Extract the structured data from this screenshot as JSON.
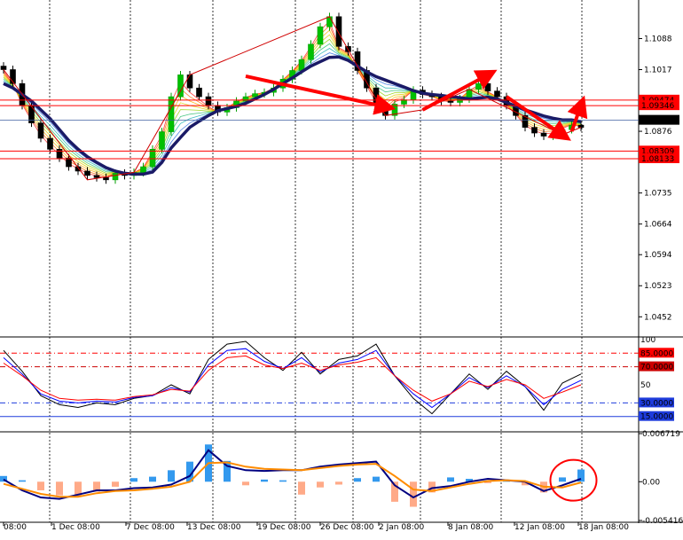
{
  "chart_data": [
    {
      "type": "candlestick",
      "title": "",
      "price_axis_ticks": [
        1.1088,
        1.1017,
        1.0876,
        1.0735,
        1.0664,
        1.0594,
        1.0523,
        1.0452
      ],
      "ylim": [
        1.041,
        1.117
      ],
      "horizontal_levels": [
        {
          "label": "1.09474",
          "value": 1.09474,
          "color": "#ff0000"
        },
        {
          "label": "1.09346",
          "value": 1.09346,
          "color": "#ff0000"
        },
        {
          "label": "1.08309",
          "value": 1.08309,
          "color": "#ff0000"
        },
        {
          "label": "1.08133",
          "value": 1.08133,
          "color": "#ff0000"
        }
      ],
      "current_price": {
        "label": "1.09012",
        "value": 1.09012
      },
      "series": [
        {
          "name": "",
          "role": "close",
          "values": [
            1.1017,
            1.0985,
            1.0935,
            1.0895,
            1.086,
            1.0835,
            1.0815,
            1.0795,
            1.0785,
            1.0775,
            1.077,
            1.0765,
            1.078,
            1.0775,
            1.0782,
            1.0795,
            1.0835,
            1.0875,
            1.0955,
            1.1005,
            1.0975,
            1.0955,
            1.0935,
            1.092,
            1.093,
            1.0945,
            1.0955,
            1.0962,
            1.0965,
            1.0975,
            1.0995,
            1.1015,
            1.104,
            1.1075,
            1.1115,
            1.1138,
            1.107,
            1.1058,
            1.1015,
            1.0975,
            1.0935,
            1.0912,
            1.0938,
            1.0948,
            1.097,
            1.096,
            1.0955,
            1.0945,
            1.0942,
            1.095,
            1.0972,
            1.0985,
            1.0968,
            1.0955,
            1.0935,
            1.0912,
            1.0885,
            1.0872,
            1.0865,
            1.0868,
            1.088,
            1.089,
            1.0885
          ]
        },
        {
          "name": "",
          "role": "moving-average",
          "values": [
            1.0985,
            1.0975,
            1.096,
            1.0945,
            1.0925,
            1.0905,
            1.088,
            1.0855,
            1.0835,
            1.0818,
            1.0805,
            1.0793,
            1.0785,
            1.078,
            1.0778,
            1.0778,
            1.0783,
            1.0805,
            1.0838,
            1.0862,
            1.0885,
            1.0899,
            1.0912,
            1.0923,
            1.0928,
            1.0933,
            1.094,
            1.095,
            1.096,
            1.0972,
            1.0985,
            1.0998,
            1.1012,
            1.1025,
            1.1035,
            1.1045,
            1.1046,
            1.1038,
            1.1025,
            1.1012,
            1.1001,
            1.0993,
            1.0985,
            1.0977,
            1.0969,
            1.0963,
            1.096,
            1.0958,
            1.0955,
            1.0953,
            1.095,
            1.0952,
            1.0954,
            1.095,
            1.0942,
            1.0933,
            1.0925,
            1.0918,
            1.0911,
            1.0906,
            1.0902,
            1.0902,
            1.0898
          ]
        }
      ],
      "trend_arrows": [
        {
          "from": [
            26,
            1.1002
          ],
          "to": [
            41,
            1.0932
          ],
          "color": "#ff0000"
        },
        {
          "from": [
            45,
            1.0925
          ],
          "to": [
            52,
            1.1005
          ],
          "color": "#ff0000"
        },
        {
          "from": [
            54,
            1.0955
          ],
          "to": [
            60,
            1.0868
          ],
          "color": "#ff0000"
        },
        {
          "from": [
            61,
            1.0876
          ],
          "to": [
            62,
            1.0935
          ],
          "color": "#ff0000"
        }
      ],
      "x_tick_labels": [
        "08:00",
        "1 Dec 08:00",
        "7 Dec 08:00",
        "13 Dec 08:00",
        "19 Dec 08:00",
        "26 Dec 08:00",
        "2 Jan 08:00",
        "8 Jan 08:00",
        "12 Jan 08:00",
        "18 Jan 08:00"
      ],
      "xlim": [
        0,
        62
      ]
    },
    {
      "type": "line",
      "title": "",
      "ylim": [
        0,
        100
      ],
      "y_ticks": [
        {
          "label": "100",
          "value": 100
        },
        {
          "label": "50",
          "value": 50
        }
      ],
      "levels": [
        {
          "label": "85.0000",
          "value": 85,
          "color": "#ff0000",
          "style": "dashdot"
        },
        {
          "label": "70.0000",
          "value": 70,
          "color": "#cc0000",
          "style": "dashdot"
        },
        {
          "label": "30.0000",
          "value": 30,
          "color": "#1e3cdc",
          "style": "dashdot"
        },
        {
          "label": "15.0000",
          "value": 15,
          "color": "#1e3cdc",
          "style": "solid"
        }
      ],
      "x": [
        0,
        2,
        4,
        6,
        8,
        10,
        12,
        14,
        16,
        18,
        20,
        22,
        24,
        26,
        28,
        30,
        32,
        34,
        36,
        38,
        40,
        42,
        44,
        46,
        48,
        50,
        52,
        54,
        56,
        58,
        60,
        62
      ],
      "series": [
        {
          "name": "",
          "color": "#000000",
          "values": [
            88,
            65,
            38,
            28,
            25,
            30,
            28,
            35,
            38,
            50,
            40,
            78,
            95,
            98,
            80,
            66,
            86,
            62,
            78,
            82,
            95,
            60,
            35,
            18,
            40,
            62,
            45,
            65,
            48,
            22,
            52,
            62
          ]
        },
        {
          "name": "",
          "color": "#0000ff",
          "values": [
            80,
            62,
            40,
            32,
            30,
            32,
            31,
            36,
            38,
            47,
            42,
            72,
            88,
            90,
            76,
            68,
            80,
            64,
            74,
            78,
            88,
            60,
            40,
            25,
            40,
            58,
            47,
            60,
            48,
            28,
            45,
            55
          ]
        },
        {
          "name": "",
          "color": "#ff0000",
          "values": [
            74,
            60,
            44,
            35,
            33,
            34,
            33,
            37,
            39,
            45,
            43,
            66,
            80,
            82,
            72,
            68,
            74,
            66,
            72,
            75,
            80,
            60,
            44,
            32,
            40,
            54,
            48,
            56,
            50,
            35,
            42,
            50
          ]
        }
      ]
    },
    {
      "type": "bar",
      "title": "",
      "ylim": [
        -0.005416,
        0.006719
      ],
      "y_ticks": [
        {
          "label": "0.006719",
          "value": 0.006719
        },
        {
          "label": "0.00",
          "value": 0
        },
        {
          "label": "-0.005416",
          "value": -0.005416
        }
      ],
      "x": [
        0,
        2,
        4,
        6,
        8,
        10,
        12,
        14,
        16,
        18,
        20,
        22,
        24,
        26,
        28,
        30,
        32,
        34,
        36,
        38,
        40,
        42,
        44,
        46,
        48,
        50,
        52,
        54,
        56,
        58,
        60,
        62
      ],
      "values": [
        0.0008,
        0.0002,
        -0.0012,
        -0.0019,
        -0.0021,
        -0.0014,
        -0.0007,
        0.0005,
        0.0007,
        0.0016,
        0.0028,
        0.0052,
        0.0029,
        -0.0005,
        0.0003,
        0.0002,
        -0.0018,
        -0.0008,
        -0.0004,
        0.0005,
        0.0007,
        -0.0028,
        -0.0035,
        -0.0015,
        0.0006,
        0.0004,
        -0.0002,
        0.0002,
        -0.0005,
        -0.0015,
        0.0006,
        0.0017
      ],
      "series": [
        {
          "name": "",
          "color": "#000080",
          "values": [
            0.0003,
            -0.0012,
            -0.0022,
            -0.0024,
            -0.0018,
            -0.0012,
            -0.0012,
            -0.0009,
            -0.0008,
            -0.0004,
            0.0008,
            0.0044,
            0.0022,
            0.0016,
            0.0015,
            0.0016,
            0.0016,
            0.0021,
            0.0024,
            0.0026,
            0.0028,
            -0.0005,
            -0.0022,
            -0.0009,
            -0.0006,
            0.0,
            0.0004,
            0.0002,
            0.0,
            -0.0013,
            -0.0005,
            0.0004
          ]
        },
        {
          "name": "",
          "color": "#ff8c00",
          "values": [
            -0.0003,
            -0.001,
            -0.0017,
            -0.0021,
            -0.0021,
            -0.0016,
            -0.0013,
            -0.0012,
            -0.001,
            -0.0007,
            0.0,
            0.0026,
            0.0027,
            0.0021,
            0.0018,
            0.0017,
            0.0016,
            0.0019,
            0.0022,
            0.0024,
            0.0025,
            0.0008,
            -0.0011,
            -0.0013,
            -0.0008,
            -0.0003,
            0.0001,
            0.0002,
            0.0001,
            -0.0007,
            -0.0008,
            -0.0001
          ]
        }
      ],
      "annotation": {
        "shape": "circle",
        "color": "#ff0000",
        "at_x": 61
      }
    }
  ]
}
